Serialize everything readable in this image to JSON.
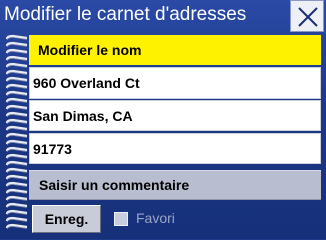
{
  "window": {
    "title": "Modifier le carnet d'adresses"
  },
  "header": {
    "label": "Modifier le nom"
  },
  "fields": [
    {
      "value": "960 Overland Ct"
    },
    {
      "value": "San Dimas, CA"
    },
    {
      "value": "91773"
    }
  ],
  "comment": {
    "label": "Saisir un commentaire"
  },
  "footer": {
    "save_label": "Enreg.",
    "favorite_label": "Favori",
    "favorite_checked": false
  },
  "icons": {
    "close": "close-icon",
    "binding": "spiral-binding-icon"
  },
  "colors": {
    "background": "#1c3786",
    "header": "#fff200",
    "field": "#ffffff",
    "comment": "#b8bdd0",
    "button": "#c8cbd8"
  }
}
